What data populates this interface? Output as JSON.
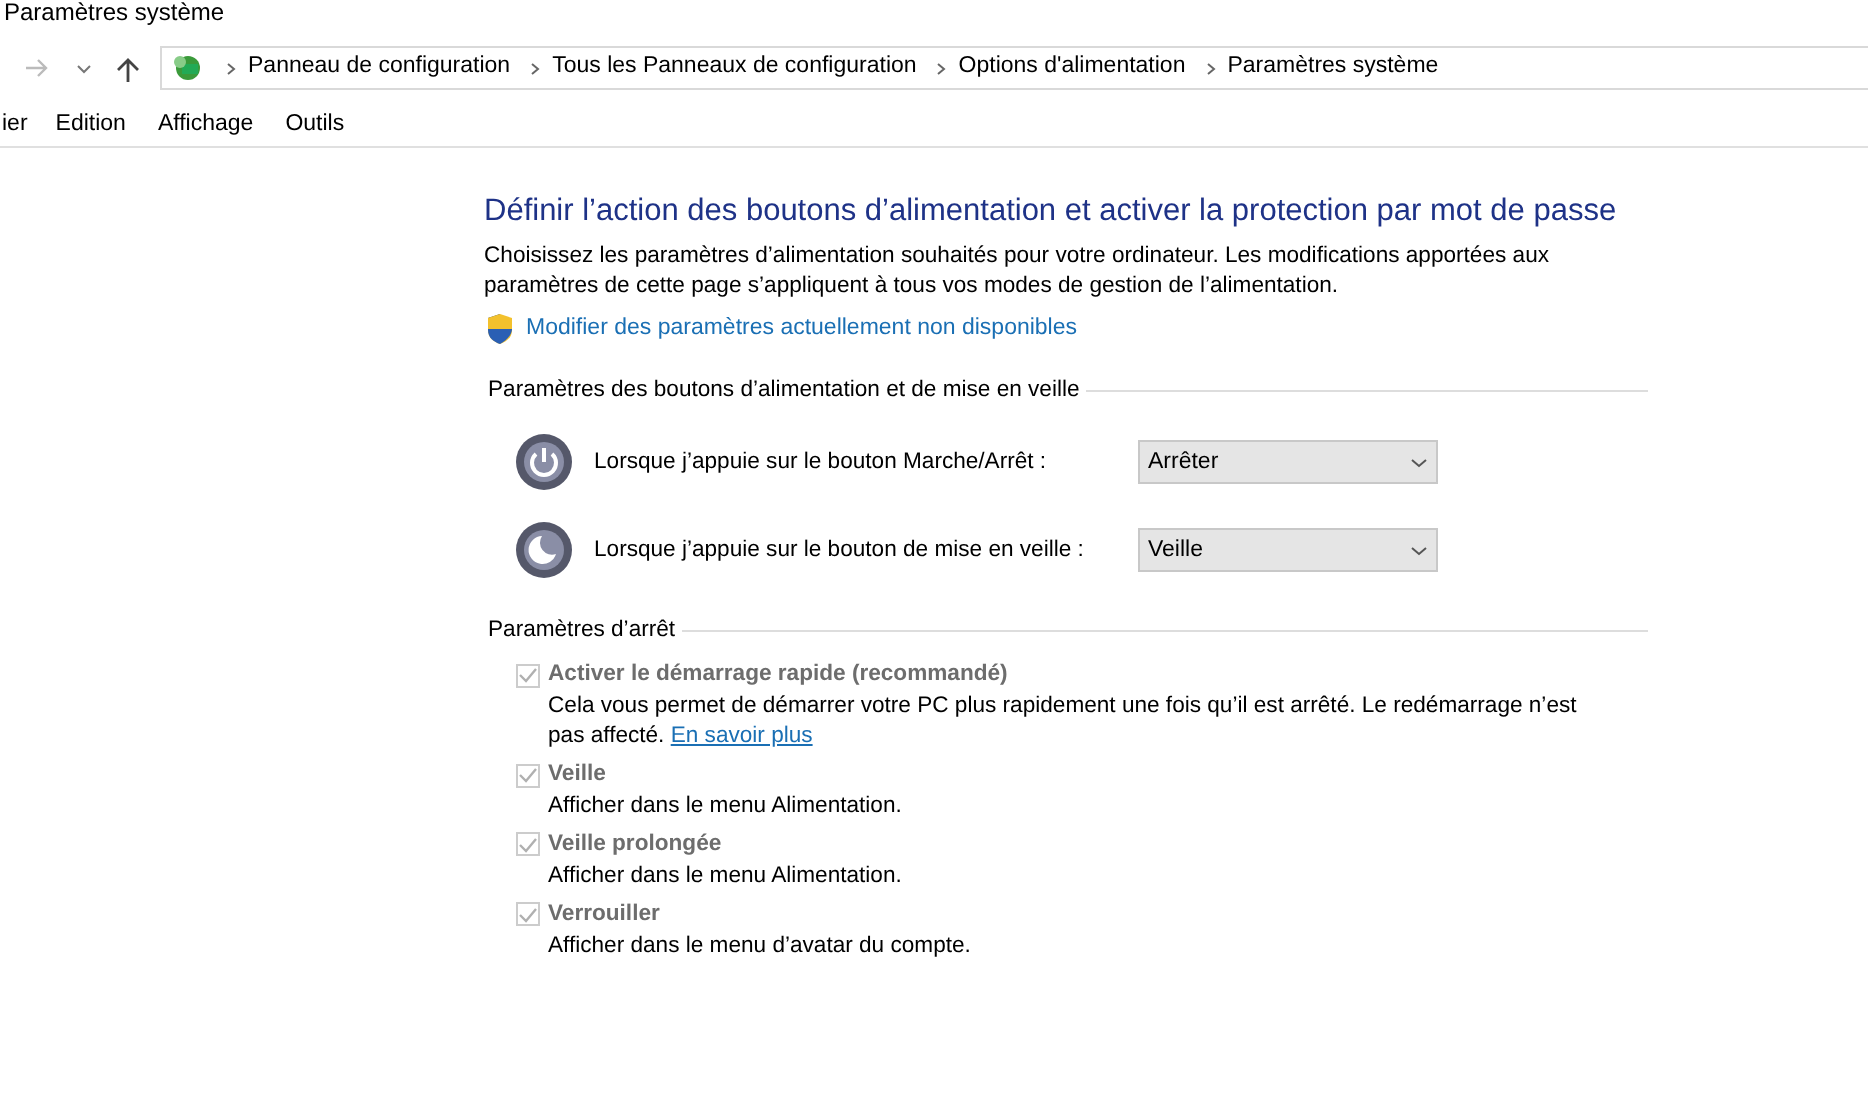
{
  "window": {
    "title": "Paramètres système"
  },
  "address_bar": {
    "breadcrumbs": [
      "Panneau de configuration",
      "Tous les Panneaux de configuration",
      "Options d'alimentation",
      "Paramètres système"
    ]
  },
  "menu": [
    "ier",
    "Edition",
    "Affichage",
    "Outils"
  ],
  "heading": "Définir l’action des boutons d’alimentation et activer la protection par mot de passe",
  "intro": "Choisissez les paramètres d’alimentation souhaités pour votre ordinateur. Les modifications apportées aux paramètres de cette page s’appliquent à tous vos modes de gestion de l’alimentation.",
  "admin_link": "Modifier des paramètres actuellement non disponibles",
  "buttons_section": {
    "title": "Paramètres des boutons d’alimentation et de mise en veille",
    "rows": [
      {
        "kind": "power",
        "label": "Lorsque j’appuie sur le bouton Marche/Arrêt :",
        "value": "Arrêter"
      },
      {
        "kind": "sleep",
        "label": "Lorsque j’appuie sur le bouton de mise en veille :",
        "value": "Veille"
      }
    ]
  },
  "shutdown_section": {
    "title": "Paramètres d’arrêt",
    "options": [
      {
        "label": "Activer le démarrage rapide (recommandé)",
        "checked": true,
        "disabled": true,
        "description": "Cela vous permet de démarrer votre PC plus rapidement une fois qu’il est arrêté. Le redémarrage n’est pas affecté.",
        "link": "En savoir plus"
      },
      {
        "label": "Veille",
        "checked": true,
        "disabled": true,
        "description": "Afficher dans le menu Alimentation."
      },
      {
        "label": "Veille prolongée",
        "checked": true,
        "disabled": true,
        "description": "Afficher dans le menu Alimentation."
      },
      {
        "label": "Verrouiller",
        "checked": true,
        "disabled": true,
        "description": "Afficher dans le menu d’avatar du compte."
      }
    ]
  }
}
